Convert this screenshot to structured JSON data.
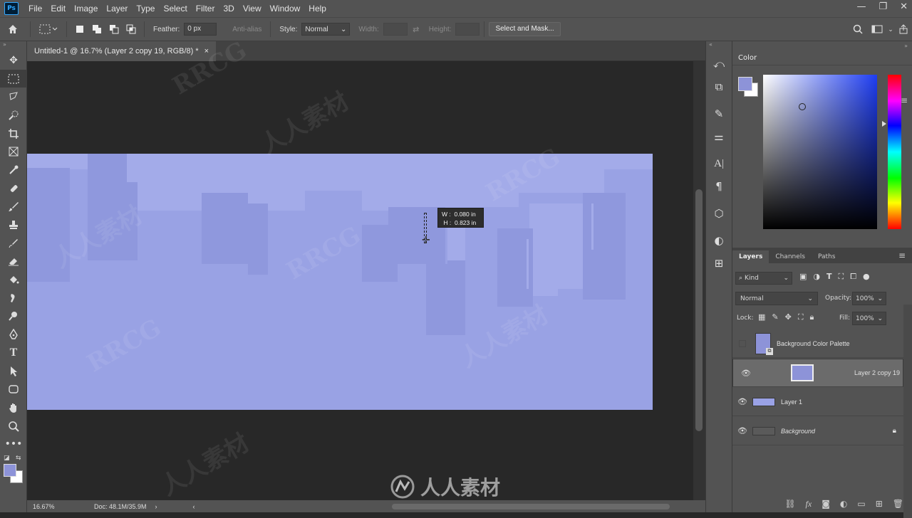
{
  "menu": {
    "app_icon": "Ps",
    "items": [
      "File",
      "Edit",
      "Image",
      "Layer",
      "Type",
      "Select",
      "Filter",
      "3D",
      "View",
      "Window",
      "Help"
    ]
  },
  "options": {
    "feather_label": "Feather:",
    "feather_value": "0 px",
    "antialias_label": "Anti-alias",
    "style_label": "Style:",
    "style_value": "Normal",
    "width_label": "Width:",
    "height_label": "Height:",
    "select_mask_label": "Select and Mask..."
  },
  "document": {
    "tab_title": "Untitled-1 @ 16.7% (Layer 2 copy 19, RGB/8) *",
    "close_glyph": "×",
    "fill_color": "#99a2e4",
    "shape_color": "#8c95dc",
    "light_color": "#a3abe9"
  },
  "measure": {
    "w_label": "W :",
    "w_value": "0.080 in",
    "h_label": "H :",
    "h_value": "0.823 in"
  },
  "status": {
    "zoom": "16.67%",
    "doc": "Doc: 48.1M/35.9M"
  },
  "color_panel": {
    "title": "Color",
    "foreground": "#8d93d8",
    "background": "#ffffff"
  },
  "layers_panel": {
    "tabs": [
      "Layers",
      "Channels",
      "Paths"
    ],
    "kind_label": "Kind",
    "blend_mode": "Normal",
    "opacity_label": "Opacity:",
    "opacity_value": "100%",
    "lock_label": "Lock:",
    "fill_label": "Fill:",
    "fill_value": "100%",
    "layers": [
      {
        "name": "Background Color Palette",
        "visible": false,
        "selected": false
      },
      {
        "name": "Layer 2 copy 19",
        "visible": true,
        "selected": true
      },
      {
        "name": "Layer 1",
        "visible": true,
        "selected": false
      },
      {
        "name": "Background",
        "visible": true,
        "selected": false
      }
    ]
  },
  "watermark": {
    "latin": "RRCG",
    "cjk": "人人素材"
  }
}
